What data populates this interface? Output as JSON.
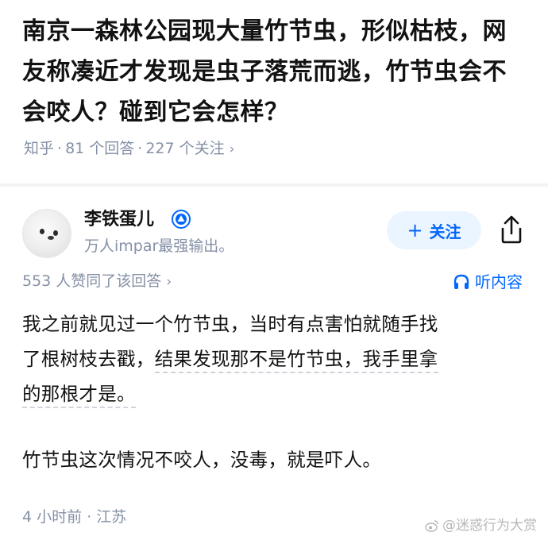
{
  "question": {
    "title": "南京一森林公园现大量竹节虫，形似枯枝，网友称凑近才发现是虫子落荒而逃，竹节虫会不会咬人？碰到它会怎样？",
    "source": "知乎",
    "answer_count": "81 个回答",
    "follower_count": "227 个关注",
    "chevron": "›"
  },
  "author": {
    "name": "李铁蛋儿",
    "bio": "万人impar最强输出。",
    "avatar_icon": "seal-avatar",
    "badge_icon": "verified-badge-icon",
    "follow_plus": "+",
    "follow_label": "关注",
    "share_icon": "share-icon"
  },
  "answer": {
    "upvote_text": "553 人赞同了该回答",
    "chevron": "›",
    "listen_label": "听内容",
    "listen_icon": "headphones-icon",
    "lines": [
      "我之前就见过一个竹节虫，当时有点害怕就随手找",
      "了根树枝去戳，",
      "结果发现那不是竹节虫，我手里拿",
      "的那根才是。",
      "竹节虫这次情况不咬人，没毒，就是吓人。"
    ],
    "time": "4 小时前",
    "location": "江苏"
  },
  "watermark": {
    "text": "@迷惑行为大赏"
  },
  "colors": {
    "primary": "#0066ff",
    "meta_gray": "#8590a6",
    "text": "#121212",
    "follow_bg": "#ebf5ff"
  }
}
